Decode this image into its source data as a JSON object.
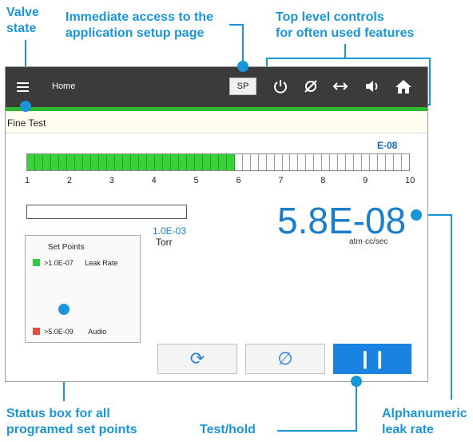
{
  "callouts": {
    "valve_state": [
      "Valve",
      "state"
    ],
    "setup_page": [
      "Immediate access to the",
      "application setup page"
    ],
    "top_controls": [
      "Top level controls",
      "for often used features"
    ],
    "status_box": [
      "Status box for all",
      "programed set points"
    ],
    "test_hold": [
      "Test/hold"
    ],
    "leak_rate": [
      "Alphanumeric",
      "leak rate"
    ]
  },
  "topbar": {
    "menu_icon": "hamburger-icon",
    "title": "Home",
    "sp_label": "SP",
    "controls": [
      "power-icon",
      "zero-icon",
      "swap-icon",
      "volume-icon",
      "home-icon"
    ]
  },
  "status_line": "Fine Test",
  "bargraph": {
    "exponent_label": "E-08",
    "segments_total": 48,
    "segments_lit": 26,
    "ticks": [
      "1",
      "2",
      "3",
      "4",
      "5",
      "6",
      "7",
      "8",
      "9",
      "10"
    ]
  },
  "pressure": {
    "value": "1.0E-03",
    "unit": "Torr"
  },
  "leak_rate": {
    "value": "5.8E-08",
    "unit": "atm·cc/sec"
  },
  "set_points": {
    "title": "Set Points",
    "items": [
      {
        "color": "#2ecc40",
        "value": ">1.0E-07",
        "label": "Leak Rate"
      },
      {
        "color": "#e74c3c",
        "value": ">5.0E-09",
        "label": "Audio"
      }
    ]
  },
  "buttons": {
    "refresh": "⟳",
    "zero": "∅",
    "hold": "❙❙"
  },
  "colors": {
    "accent": "#1a96d6",
    "bar_green": "#39d23a",
    "hold_blue": "#1a82e0"
  }
}
